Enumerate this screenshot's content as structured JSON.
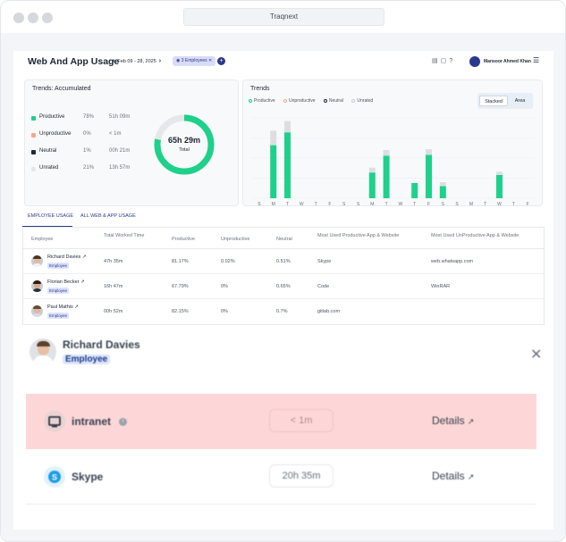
{
  "window": {
    "url_title": "Traqnext"
  },
  "header": {
    "title": "Web And App Usage",
    "date_from": "Feb 09",
    "date_sep": "-",
    "date_to": "28, 2025",
    "employee_chip": "3 Employees",
    "user_name": "Mansoor Ahmed Khan"
  },
  "accumulated": {
    "title": "Trends: Accumulated",
    "rows": [
      {
        "name": "Productive",
        "percent": "78%",
        "time": "51h 09m",
        "color": "#1ed18a"
      },
      {
        "name": "Unproductive",
        "percent": "0%",
        "time": "< 1m",
        "color": "#f2a98b"
      },
      {
        "name": "Neutral",
        "percent": "1%",
        "time": "00h 21m",
        "color": "#1f2a37"
      },
      {
        "name": "Unrated",
        "percent": "21%",
        "time": "13h 57m",
        "color": "#e6e7ea"
      }
    ],
    "total_value": "65h 29m",
    "total_label": "Total",
    "donut_shares": [
      0.78,
      0.0,
      0.01,
      0.21
    ]
  },
  "trends": {
    "title": "Trends",
    "legend": [
      {
        "name": "Productive",
        "color": "#1ed18a"
      },
      {
        "name": "Unproductive",
        "color": "#f2a98b"
      },
      {
        "name": "Neutral",
        "color": "#1f2a37"
      },
      {
        "name": "Unrated",
        "color": "#c9ccd2"
      }
    ],
    "toggle": {
      "stacked": "Stacked",
      "area": "Area"
    }
  },
  "chart_data": {
    "type": "bar",
    "stacked": true,
    "categories": [
      "S",
      "M",
      "T",
      "W",
      "T",
      "F",
      "S",
      "S",
      "M",
      "T",
      "W",
      "T",
      "F",
      "S",
      "S",
      "M",
      "T",
      "W",
      "T",
      "F"
    ],
    "series": [
      {
        "name": "Productive",
        "color": "#1ed18a",
        "values": [
          0,
          0.66,
          0.82,
          0,
          0,
          0,
          0,
          0,
          0.32,
          0.53,
          0,
          0.19,
          0.54,
          0.15,
          0,
          0,
          0,
          0.29,
          0,
          0,
          0
        ]
      },
      {
        "name": "Unrated",
        "color": "#dcdee2",
        "values": [
          0,
          0.18,
          0.14,
          0,
          0,
          0,
          0,
          0,
          0.06,
          0.07,
          0,
          0.0,
          0.07,
          0.05,
          0,
          0,
          0,
          0.04,
          0,
          0,
          0
        ]
      }
    ],
    "ylim": [
      0,
      1
    ],
    "grid": true
  },
  "tabs": [
    {
      "label": "EMPLOYEE USAGE"
    },
    {
      "label": "ALL WEB & APP USAGE"
    }
  ],
  "table": {
    "headers": [
      "Employee",
      "Total Worked Time",
      "Productive",
      "Unproductive",
      "Neutral",
      "Most Used Productive App & Website",
      "Most Used UnProductive App & Website"
    ],
    "rows": [
      {
        "name": "Richard Davies",
        "role": "Employee",
        "time": "47h 35m",
        "productive": "81.17%",
        "unproductive": "0.02%",
        "neutral": "0.51%",
        "prod_app": "Skype",
        "unprod_app": "web.whatsapp.com"
      },
      {
        "name": "Florian Becker",
        "role": "Employee",
        "time": "16h 47m",
        "productive": "67.79%",
        "unproductive": "0%",
        "neutral": "0.65%",
        "prod_app": "Code",
        "unprod_app": "WinRAR"
      },
      {
        "name": "Paul Mathis",
        "role": "Employee",
        "time": "00h 52m",
        "productive": "82.15%",
        "unproductive": "0%",
        "neutral": "0.7%",
        "prod_app": "gitlab.com",
        "unprod_app": ""
      }
    ]
  },
  "panel": {
    "name": "Richard Davies",
    "role": "Employee",
    "apps": [
      {
        "name": "intranet",
        "time": "< 1m",
        "details": "Details",
        "icon": "monitor-icon"
      },
      {
        "name": "Skype",
        "time": "20h 35m",
        "details": "Details",
        "icon": "skype-icon"
      }
    ]
  }
}
